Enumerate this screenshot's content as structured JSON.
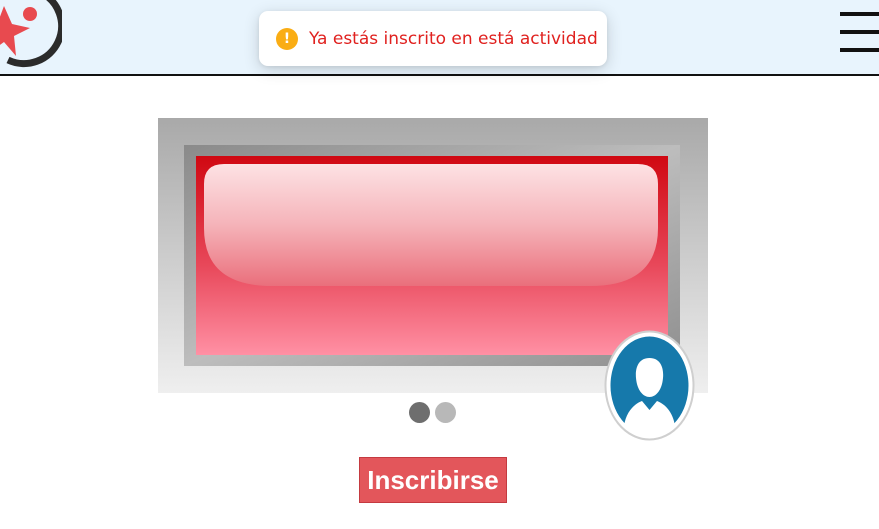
{
  "header": {
    "logo_icon": "star-person-logo-icon",
    "menu_icon": "hamburger-menu-icon"
  },
  "toast": {
    "icon": "warning-icon",
    "icon_symbol": "!",
    "message": "Ya estás inscrito en está actividad",
    "color": "#e0211f",
    "icon_color": "#faad14"
  },
  "carousel": {
    "slide_count": 2,
    "active_index": 0,
    "slide_icon": "red-glossy-button-image"
  },
  "avatar": {
    "icon": "user-avatar-icon",
    "color": "#1679ab"
  },
  "actions": {
    "enroll_label": "Inscribirse",
    "enroll_color": "#e3565b"
  }
}
